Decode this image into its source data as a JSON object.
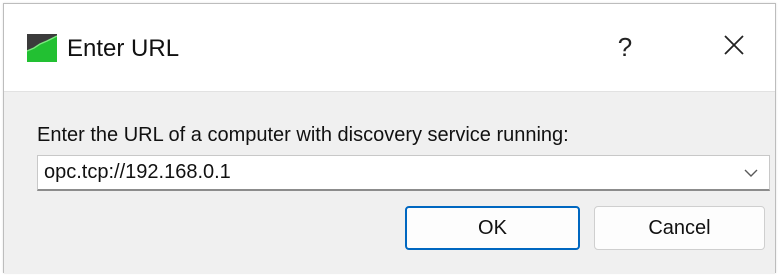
{
  "window": {
    "title": "Enter URL",
    "help_glyph": "?",
    "app_icon": "green-chart-app-icon",
    "close_icon": "close-icon"
  },
  "form": {
    "prompt": "Enter the URL of a computer with discovery service running:",
    "url_value": "opc.tcp://192.168.0.1",
    "dropdown_icon": "chevron-down-icon"
  },
  "buttons": {
    "ok_label": "OK",
    "cancel_label": "Cancel"
  },
  "colors": {
    "accent": "#0067c0",
    "icon_green": "#22c032",
    "icon_dark": "#3b3b3b"
  }
}
